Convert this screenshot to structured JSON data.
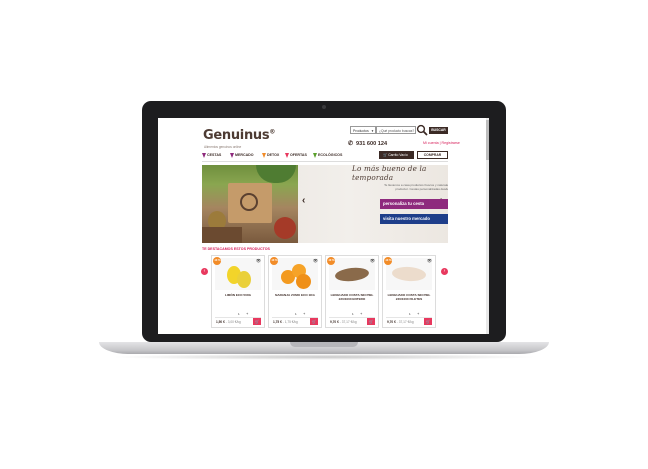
{
  "header": {
    "logo": "Genuinus",
    "logo_mark": "®",
    "tagline": "Alimentos genuinos online",
    "search_category": "Productos",
    "search_placeholder": "¿Qué producto buscas?",
    "search_button": "BUSCAR",
    "phone": "931 600 124",
    "account_link": "Mi cuenta",
    "register_link": "Registrarse",
    "cart_label": "Carrito Vacío",
    "checkout_button": "COMPRAR"
  },
  "nav": {
    "items": [
      {
        "label": "CESTAS",
        "color": "#8e2a7d"
      },
      {
        "label": "MERCADO",
        "color": "#8e2a7d"
      },
      {
        "label": "DETOX",
        "color": "#f28c28"
      },
      {
        "label": "OFERTAS",
        "color": "#e8385e"
      },
      {
        "label": "ECOLÓGICOS",
        "color": "#5aa02c"
      }
    ]
  },
  "banner": {
    "title": "Lo más bueno de la temporada",
    "text": "Te llevamos a casa productos frescos y naturales directos del productor. Cestas personalizadas desde 23€",
    "cta_primary": "personaliza tu cesta",
    "cta_secondary": "visita nuestro mercado"
  },
  "products_section": {
    "title": "TE DESTACAMOS ESTOS PRODUCTOS",
    "items": [
      {
        "badge": "-10 %",
        "name": "LIMÓN ECO 500G",
        "qty": "1",
        "price": "1,50 €",
        "unit_price": "- 3,00 €/kg"
      },
      {
        "badge": "-10 %",
        "name": "NARANJA ZUMO ECO 1KG",
        "qty": "1",
        "price": "1,75 €",
        "unit_price": "- 1,75 €/kg"
      },
      {
        "badge": "-10 %",
        "name": "LENGUADO COSTA SIN PIEL 220/1000 ENTERO",
        "qty": "1",
        "price": "9,70 €",
        "unit_price": "- 37,17 €/kg"
      },
      {
        "badge": "-10 %",
        "name": "LENGUADO COSTA SIN PIEL 220/1000 FILETES",
        "qty": "1",
        "price": "9,70 €",
        "unit_price": "- 37,17 €/kg"
      }
    ]
  },
  "colors": {
    "brand_dark": "#3b2a25",
    "accent_pink": "#d61c58",
    "purple": "#8e2a7d",
    "navy": "#1e3e8a",
    "orange_badge": "#f28c28"
  }
}
